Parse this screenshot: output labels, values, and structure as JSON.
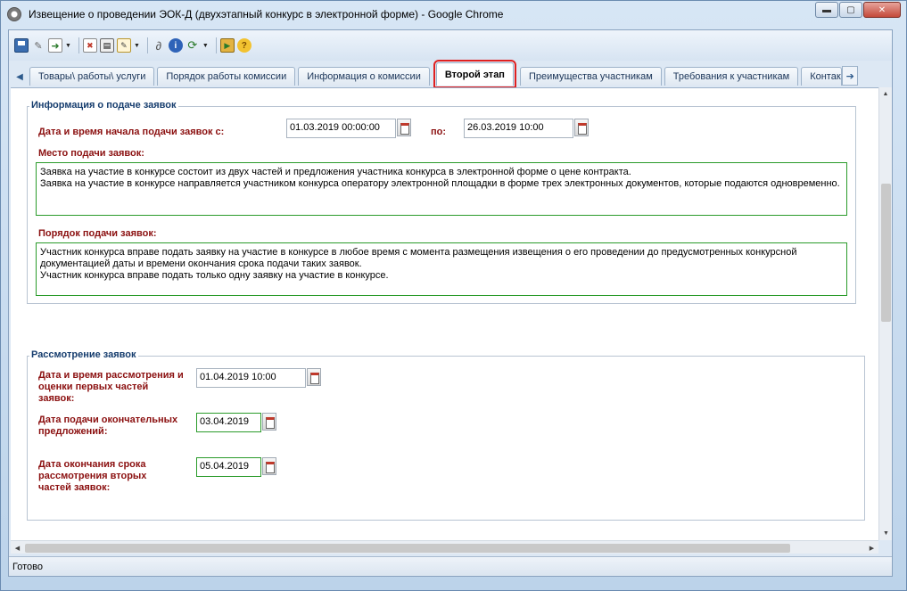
{
  "window": {
    "title": "Извещение о проведении ЭОК-Д (двухэтапный конкурс в электронной форме) - Google Chrome",
    "minimize": "▬",
    "restore": "▢",
    "close": "✕"
  },
  "toolbar": {
    "icons": [
      "save-icon",
      "attach-icon",
      "export-icon",
      "document-icon",
      "print-icon",
      "edit-doc-icon",
      "paperclip-icon",
      "info-icon",
      "refresh-icon",
      "exit-icon",
      "help-icon"
    ]
  },
  "tabs": [
    {
      "label": "Товары\\ работы\\ услуги"
    },
    {
      "label": "Порядок работы комиссии"
    },
    {
      "label": "Информация о комиссии"
    },
    {
      "label": "Второй этап"
    },
    {
      "label": "Преимущества участникам"
    },
    {
      "label": "Требования к участникам"
    },
    {
      "label": "Контакты"
    }
  ],
  "submission": {
    "legend": "Информация о подаче заявок",
    "start_label": "Дата и время начала подачи заявок с:",
    "start_value": "01.03.2019 00:00:00",
    "to_label": "по:",
    "end_value": "26.03.2019 10:00",
    "place_label": "Место подачи заявок:",
    "place_text": "Заявка на участие в конкурсе состоит из двух частей и предложения участника конкурса в электронной форме о цене контракта.\nЗаявка на участие в конкурсе направляется участником конкурса оператору электронной площадки в форме трех электронных документов, которые подаются одновременно.",
    "order_label": "Порядок подачи заявок:",
    "order_text": "Участник конкурса вправе подать заявку на участие в конкурсе в любое время с момента размещения извещения о его проведении до предусмотренных конкурсной документацией даты и времени окончания срока подачи таких заявок.\nУчастник конкурса вправе подать только одну заявку на участие в конкурсе."
  },
  "review": {
    "legend": "Рассмотрение заявок",
    "first_label": "Дата и время рассмотрения и оценки первых частей заявок:",
    "first_value": "01.04.2019 10:00",
    "final_label": "Дата подачи окончательных предложений:",
    "final_value": "03.04.2019",
    "second_label": "Дата окончания срока рассмотрения вторых частей заявок:",
    "second_value": "05.04.2019"
  },
  "status": {
    "text": "Готово"
  }
}
